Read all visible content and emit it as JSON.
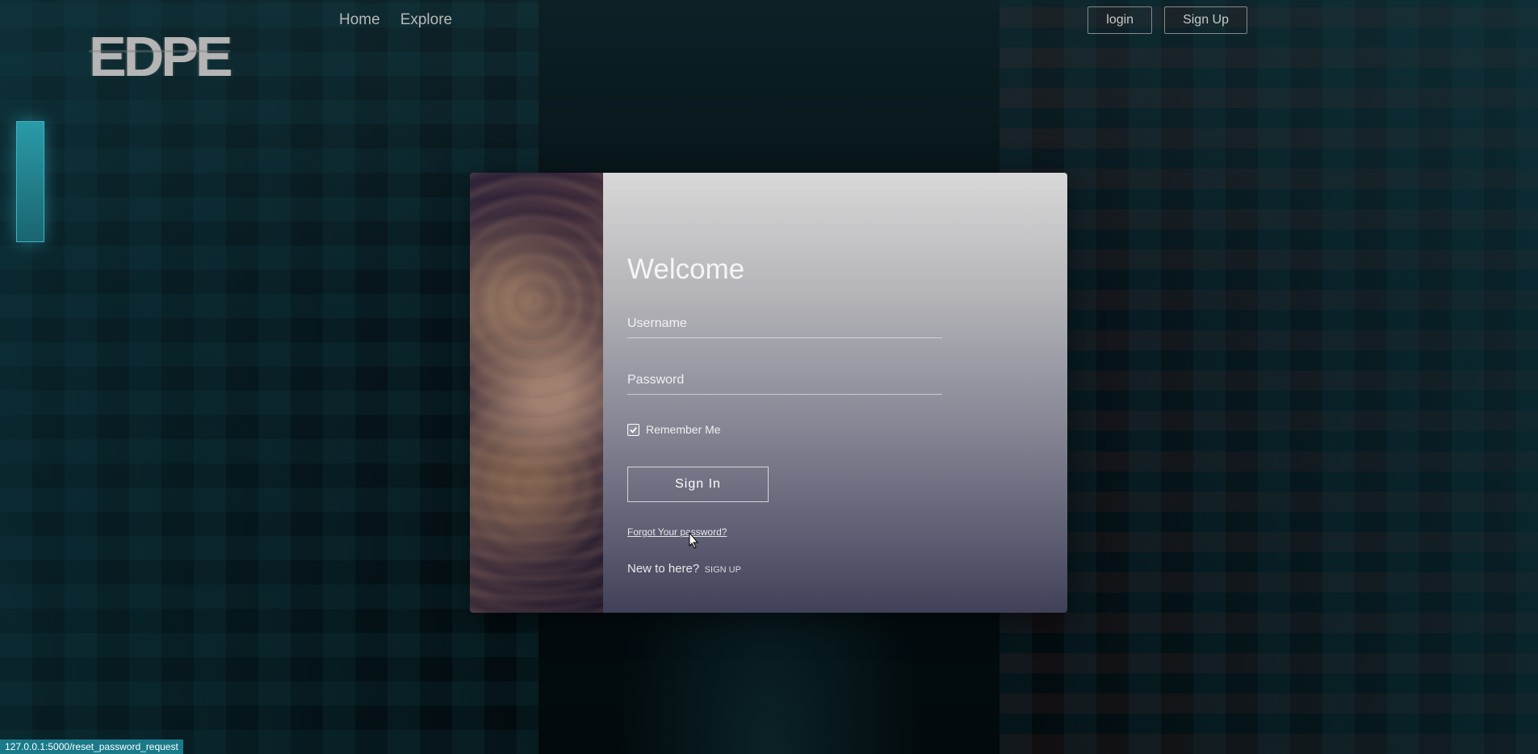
{
  "logo": "EDPE",
  "nav": {
    "links": [
      "Home",
      "Explore"
    ],
    "login_btn": "login",
    "signup_btn": "Sign Up"
  },
  "login_form": {
    "title": "Welcome",
    "username_placeholder": "Username",
    "password_placeholder": "Password",
    "remember_label": "Remember Me",
    "remember_checked": true,
    "signin_btn": "Sign In",
    "forgot_link": "Forgot Your password?",
    "new_here_text": "New to here?",
    "signup_link": "SIGN UP"
  },
  "status_bar": "127.0.0.1:5000/reset_password_request"
}
